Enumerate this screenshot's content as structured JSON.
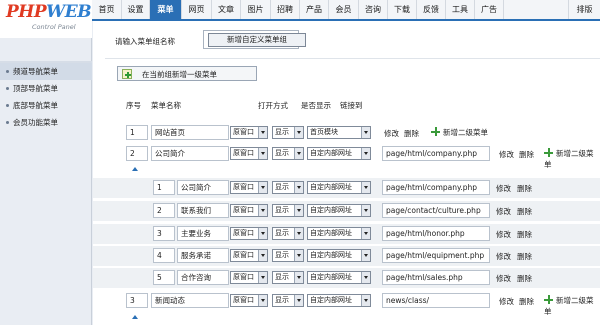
{
  "logo": {
    "brand_php": "PHP",
    "brand_web": "WEB",
    "subtitle": "Control Panel"
  },
  "topnav": {
    "tabs": [
      "首页",
      "设置",
      "菜单",
      "网页",
      "文章",
      "图片",
      "招聘",
      "产品",
      "会员",
      "咨询",
      "下载",
      "反馈",
      "工具",
      "广告"
    ],
    "active_index": 2,
    "logout": "排版"
  },
  "sidebar": {
    "items": [
      "频道导航菜单",
      "顶部导航菜单",
      "底部导航菜单",
      "会员功能菜单"
    ],
    "active_index": 0
  },
  "group": {
    "label": "请输入菜单组名称",
    "input_value": "",
    "button": "新增自定义菜单组"
  },
  "add_top": "在当前组新增一级菜单",
  "headers": {
    "order": "序号",
    "name": "菜单名称",
    "open": "打开方式",
    "visible": "是否显示",
    "link_to": "链接到"
  },
  "actions": {
    "edit": "修改",
    "delete": "删除",
    "add_sub": "新增二级菜单"
  },
  "rows": [
    {
      "order": "1",
      "name": "网站首页",
      "open": "原窗口",
      "visible": "显示",
      "target": "首页模块",
      "url": ""
    },
    {
      "order": "2",
      "name": "公司简介",
      "open": "原窗口",
      "visible": "显示",
      "target": "自定内部网址",
      "url": "page/html/company.php"
    },
    {
      "order": "1",
      "name": "公司简介",
      "open": "原窗口",
      "visible": "显示",
      "target": "自定内部网址",
      "url": "page/html/company.php"
    },
    {
      "order": "2",
      "name": "联系我们",
      "open": "原窗口",
      "visible": "显示",
      "target": "自定内部网址",
      "url": "page/contact/culture.php"
    },
    {
      "order": "3",
      "name": "主要业务",
      "open": "原窗口",
      "visible": "显示",
      "target": "自定内部网址",
      "url": "page/html/honor.php"
    },
    {
      "order": "4",
      "name": "服务承诺",
      "open": "原窗口",
      "visible": "显示",
      "target": "自定内部网址",
      "url": "page/html/equipment.php"
    },
    {
      "order": "5",
      "name": "合作咨询",
      "open": "原窗口",
      "visible": "显示",
      "target": "自定内部网址",
      "url": "page/html/sales.php"
    },
    {
      "order": "3",
      "name": "新闻动态",
      "open": "原窗口",
      "visible": "显示",
      "target": "自定内部网址",
      "url": "news/class/"
    }
  ],
  "colors": {
    "accent": "#2a6fb5",
    "logo_red": "#e03a22",
    "logo_blue": "#2f7fd0",
    "add_green": "#3a9a3a"
  }
}
